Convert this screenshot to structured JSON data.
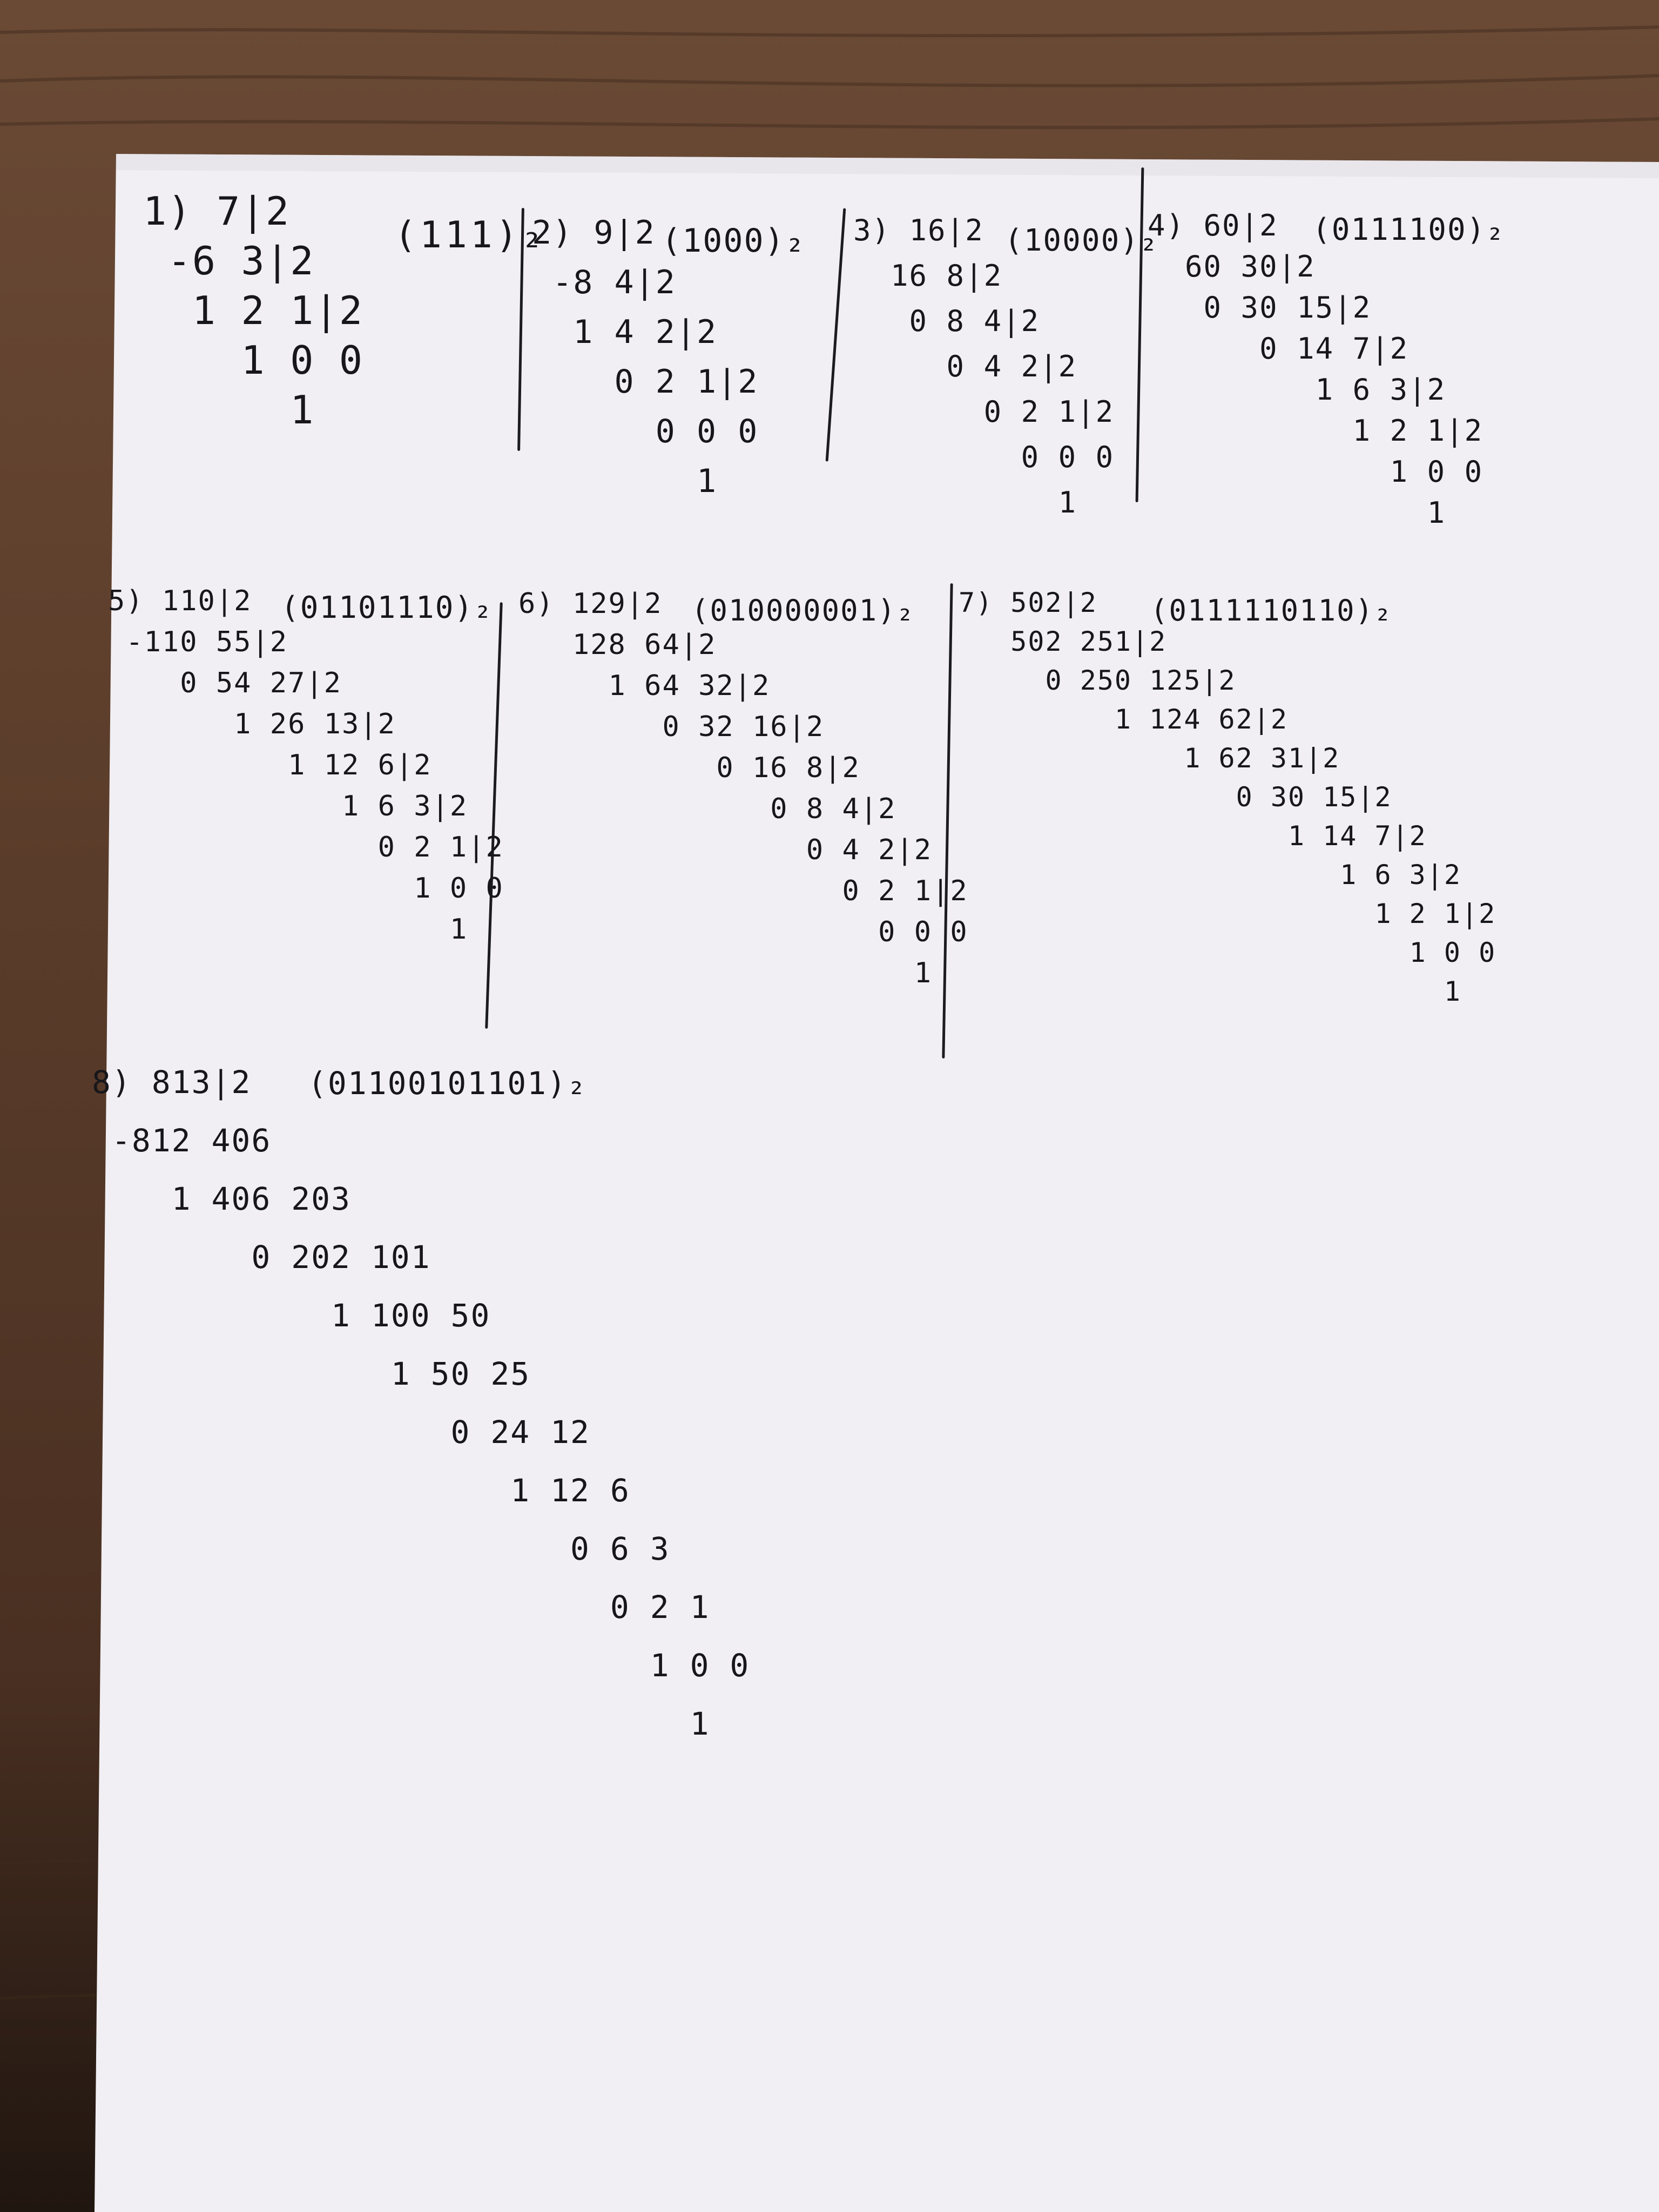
{
  "colors": {
    "paper": "#f1eff3",
    "ink": "#17171b",
    "wood": "#5a3c2a"
  },
  "problems": [
    {
      "result": "(111)₂",
      "lines": [
        "1) 7|2",
        " -6 3|2",
        "  1 2 1|2",
        "    1 0 0",
        "      1"
      ]
    },
    {
      "result": "(1000)₂",
      "lines": [
        "2) 9|2",
        " -8 4|2",
        "  1 4 2|2",
        "    0 2 1|2",
        "      0 0 0",
        "        1"
      ]
    },
    {
      "result": "(10000)₂",
      "lines": [
        "3) 16|2",
        "  16 8|2",
        "   0 8 4|2",
        "     0 4 2|2",
        "       0 2 1|2",
        "         0 0 0",
        "           1"
      ]
    },
    {
      "result": "(0111100)₂",
      "lines": [
        "4) 60|2",
        "  60 30|2",
        "   0 30 15|2",
        "      0 14 7|2",
        "         1 6 3|2",
        "           1 2 1|2",
        "             1 0 0",
        "               1"
      ]
    },
    {
      "result": "(01101110)₂",
      "lines": [
        "5) 110|2",
        " -110 55|2",
        "    0 54 27|2",
        "       1 26 13|2",
        "          1 12 6|2",
        "             1 6 3|2",
        "               0 2 1|2",
        "                 1 0 0",
        "                   1"
      ]
    },
    {
      "result": "(010000001)₂",
      "lines": [
        "6) 129|2",
        "   128 64|2",
        "     1 64 32|2",
        "        0 32 16|2",
        "           0 16 8|2",
        "              0 8 4|2",
        "                0 4 2|2",
        "                  0 2 1|2",
        "                    0 0 0",
        "                      1"
      ]
    },
    {
      "result": "(0111110110)₂",
      "lines": [
        "7) 502|2",
        "   502 251|2",
        "     0 250 125|2",
        "         1 124 62|2",
        "             1 62 31|2",
        "                0 30 15|2",
        "                   1 14 7|2",
        "                      1 6 3|2",
        "                        1 2 1|2",
        "                          1 0 0",
        "                            1"
      ]
    },
    {
      "result": "(01100101101)₂",
      "lines": [
        "8) 813|2",
        " -812 406",
        "    1 406 203",
        "        0 202 101",
        "            1 100 50",
        "               1 50 25",
        "                  0 24 12",
        "                     1 12 6",
        "                        0 6 3",
        "                          0 2 1",
        "                            1 0 0",
        "                              1"
      ]
    }
  ]
}
